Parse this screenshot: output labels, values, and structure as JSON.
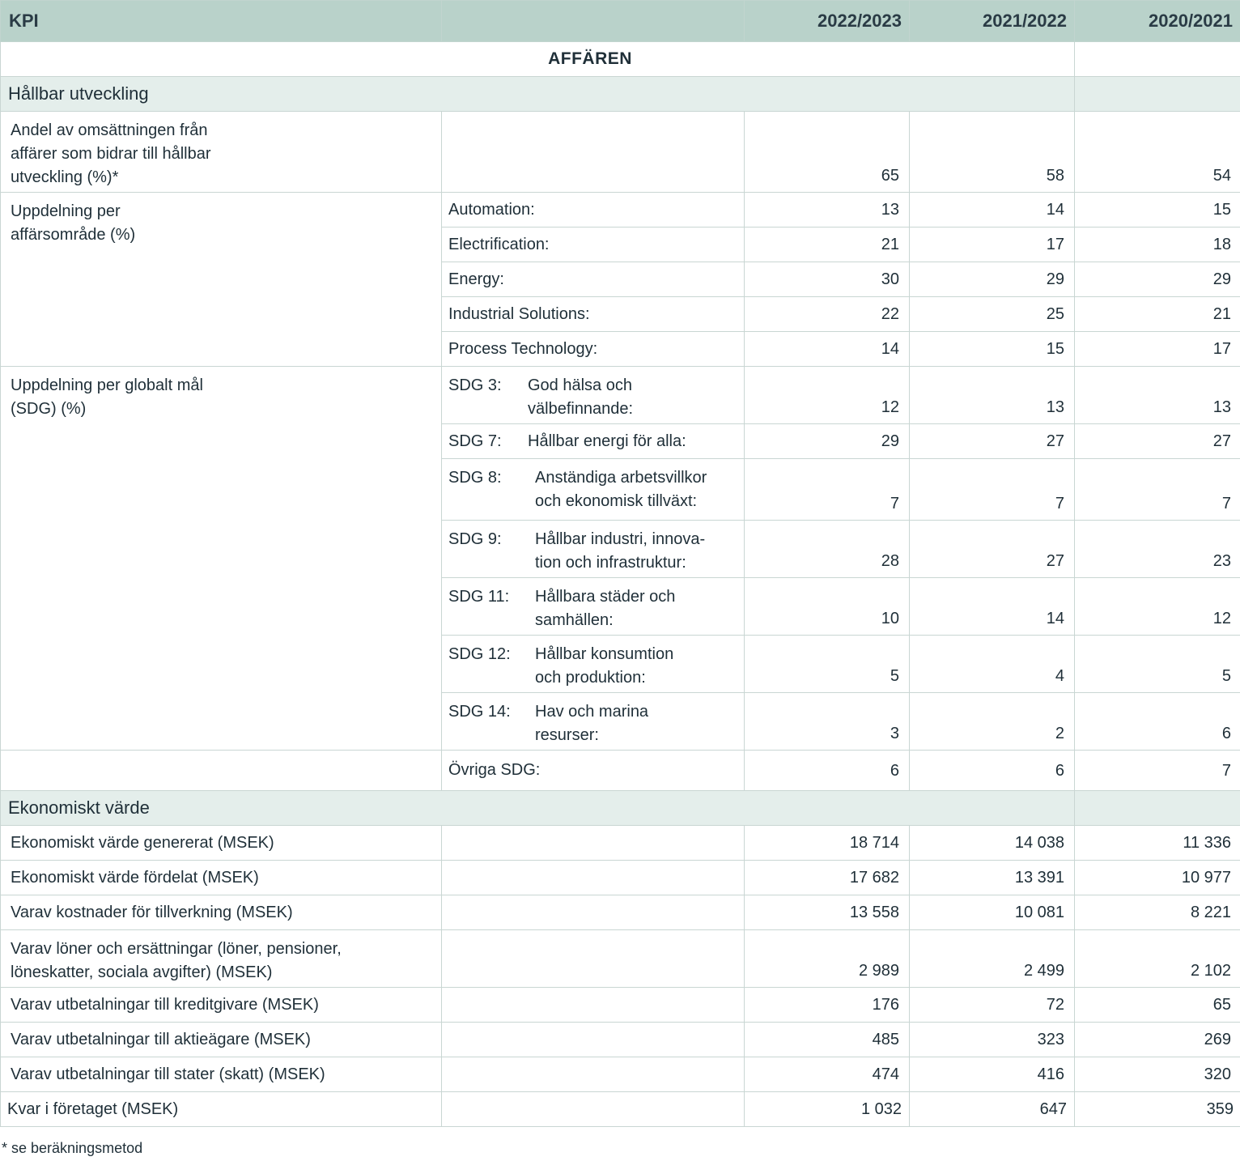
{
  "header": {
    "kpi": "KPI",
    "years": [
      "2022/2023",
      "2021/2022",
      "2020/2021"
    ]
  },
  "group_title": "AFFÄREN",
  "sections": {
    "hallbar": "Hållbar utveckling",
    "ekonomiskt": "Ekonomiskt värde"
  },
  "andel": {
    "label": "Andel av omsättningen från affärer som bidrar till hållbar utveckling (%)*",
    "values": [
      "65",
      "58",
      "54"
    ]
  },
  "affarsomrade": {
    "label": "Uppdelning per affärsområde (%)",
    "rows": [
      {
        "name": "Automation:",
        "values": [
          "13",
          "14",
          "15"
        ]
      },
      {
        "name": "Electrification:",
        "values": [
          "21",
          "17",
          "18"
        ]
      },
      {
        "name": "Energy:",
        "values": [
          "30",
          "29",
          "29"
        ]
      },
      {
        "name": "Industrial Solutions:",
        "values": [
          "22",
          "25",
          "21"
        ]
      },
      {
        "name": "Process Technology:",
        "values": [
          "14",
          "15",
          "17"
        ]
      }
    ]
  },
  "sdg": {
    "label": "Uppdelning per globalt mål (SDG) (%)",
    "rows": [
      {
        "code": "SDG 3:",
        "desc": "God hälsa och välbefinnande:",
        "values": [
          "12",
          "13",
          "13"
        ]
      },
      {
        "code": "SDG 7:",
        "desc": "Hållbar energi för alla:",
        "values": [
          "29",
          "27",
          "27"
        ]
      },
      {
        "code": "SDG 8:",
        "desc": "Anständiga arbetsvillkor och ekonomisk tillväxt:",
        "values": [
          "7",
          "7",
          "7"
        ]
      },
      {
        "code": "SDG 9:",
        "desc": "Hållbar industri, innova-tion och infrastruktur:",
        "values": [
          "28",
          "27",
          "23"
        ]
      },
      {
        "code": "SDG 11:",
        "desc": "Hållbara städer och samhällen:",
        "values": [
          "10",
          "14",
          "12"
        ]
      },
      {
        "code": "SDG 12:",
        "desc": "Hållbar konsumtion och produktion:",
        "values": [
          "5",
          "4",
          "5"
        ]
      },
      {
        "code": "SDG 14:",
        "desc": "Hav och marina resurser:",
        "values": [
          "3",
          "2",
          "6"
        ]
      }
    ],
    "other": {
      "name": "Övriga SDG:",
      "values": [
        "6",
        "6",
        "7"
      ]
    }
  },
  "economic": [
    {
      "label": "Ekonomiskt värde genererat (MSEK)",
      "values": [
        "18 714",
        "14 038",
        "11 336"
      ]
    },
    {
      "label": "Ekonomiskt värde fördelat (MSEK)",
      "values": [
        "17 682",
        "13 391",
        "10 977"
      ]
    },
    {
      "label": "Varav kostnader för tillverkning (MSEK)",
      "values": [
        "13 558",
        "10 081",
        "8 221"
      ]
    },
    {
      "label": "Varav löner och ersättningar (löner, pensioner, löneskatter, sociala avgifter) (MSEK)",
      "values": [
        "2 989",
        "2 499",
        "2 102"
      ]
    },
    {
      "label": "Varav utbetalningar till kreditgivare (MSEK)",
      "values": [
        "176",
        "72",
        "65"
      ]
    },
    {
      "label": "Varav utbetalningar till aktieägare (MSEK)",
      "values": [
        "485",
        "323",
        "269"
      ]
    },
    {
      "label": "Varav utbetalningar till stater (skatt) (MSEK)",
      "values": [
        "474",
        "416",
        "320"
      ]
    },
    {
      "label": "Kvar i företaget (MSEK)",
      "values": [
        "1 032",
        "647",
        "359"
      ]
    }
  ],
  "footnote": "* se beräkningsmetod"
}
